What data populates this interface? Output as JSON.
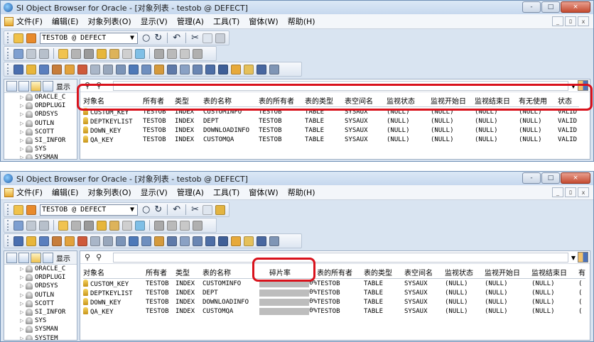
{
  "window": {
    "title": "SI Object Browser for Oracle - [对象列表 - testob @ DEFECT]",
    "caption_buttons": [
      "-",
      "□",
      "×"
    ]
  },
  "menu": [
    "文件(F)",
    "编辑(E)",
    "对象列表(O)",
    "显示(V)",
    "管理(A)",
    "工具(T)",
    "窗体(W)",
    "帮助(H)"
  ],
  "mdi_buttons": [
    "_",
    "ﾛ",
    "x"
  ],
  "connection": {
    "value": "TESTOB @ DEFECT"
  },
  "tree_items": [
    "ORACLE_C",
    "ORDPLUGI",
    "ORDSYS",
    "OUTLN",
    "SCOTT",
    "SI_INFOR",
    "SYS",
    "SYSMAN",
    "SYSTEM"
  ],
  "tree_header_label": "显示",
  "icons": {
    "filter": "binoculars-icon",
    "key": "key-icon",
    "grid_layout": "grid-layout-icon"
  },
  "grid_before": {
    "columns": [
      "对象名",
      "所有者",
      "类型",
      "表的名称",
      "表的所有者",
      "表的类型",
      "表空间名",
      "监视状态",
      "监视开始日",
      "监视结束日",
      "有无使用",
      "状态"
    ],
    "rows": [
      [
        "CUSTOM_KEY",
        "TESTOB",
        "INDEX",
        "CUSTOMINFO",
        "TESTOB",
        "TABLE",
        "SYSAUX",
        "(NULL)",
        "(NULL)",
        "(NULL)",
        "(NULL)",
        "VALID"
      ],
      [
        "DEPTKEYLIST",
        "TESTOB",
        "INDEX",
        "DEPT",
        "TESTOB",
        "TABLE",
        "SYSAUX",
        "(NULL)",
        "(NULL)",
        "(NULL)",
        "(NULL)",
        "VALID"
      ],
      [
        "DOWN_KEY",
        "TESTOB",
        "INDEX",
        "DOWNLOADINFO",
        "TESTOB",
        "TABLE",
        "SYSAUX",
        "(NULL)",
        "(NULL)",
        "(NULL)",
        "(NULL)",
        "VALID"
      ],
      [
        "QA_KEY",
        "TESTOB",
        "INDEX",
        "CUSTOMQA",
        "TESTOB",
        "TABLE",
        "SYSAUX",
        "(NULL)",
        "(NULL)",
        "(NULL)",
        "(NULL)",
        "VALID"
      ]
    ]
  },
  "grid_after": {
    "columns": [
      "对象名",
      "所有者",
      "类型",
      "表的名称",
      "碎片率",
      "表的所有者",
      "表的类型",
      "表空间名",
      "监视状态",
      "监视开始日",
      "监视结束日",
      "有"
    ],
    "rows": [
      [
        "CUSTOM_KEY",
        "TESTOB",
        "INDEX",
        "CUSTOMINFO",
        "0%",
        "TESTOB",
        "TABLE",
        "SYSAUX",
        "(NULL)",
        "(NULL)",
        "(NULL)",
        "("
      ],
      [
        "DEPTKEYLIST",
        "TESTOB",
        "INDEX",
        "DEPT",
        "0%",
        "TESTOB",
        "TABLE",
        "SYSAUX",
        "(NULL)",
        "(NULL)",
        "(NULL)",
        "("
      ],
      [
        "DOWN_KEY",
        "TESTOB",
        "INDEX",
        "DOWNLOADINFO",
        "0%",
        "TESTOB",
        "TABLE",
        "SYSAUX",
        "(NULL)",
        "(NULL)",
        "(NULL)",
        "("
      ],
      [
        "QA_KEY",
        "TESTOB",
        "INDEX",
        "CUSTOMQA",
        "0%",
        "TESTOB",
        "TABLE",
        "SYSAUX",
        "(NULL)",
        "(NULL)",
        "(NULL)",
        "("
      ]
    ],
    "fragmentation_bar_fraction": 0
  },
  "colors": {
    "callout": "#d9121c",
    "window_frame": "#d9e4f1",
    "fragment_bar": "#bdbdbd"
  }
}
